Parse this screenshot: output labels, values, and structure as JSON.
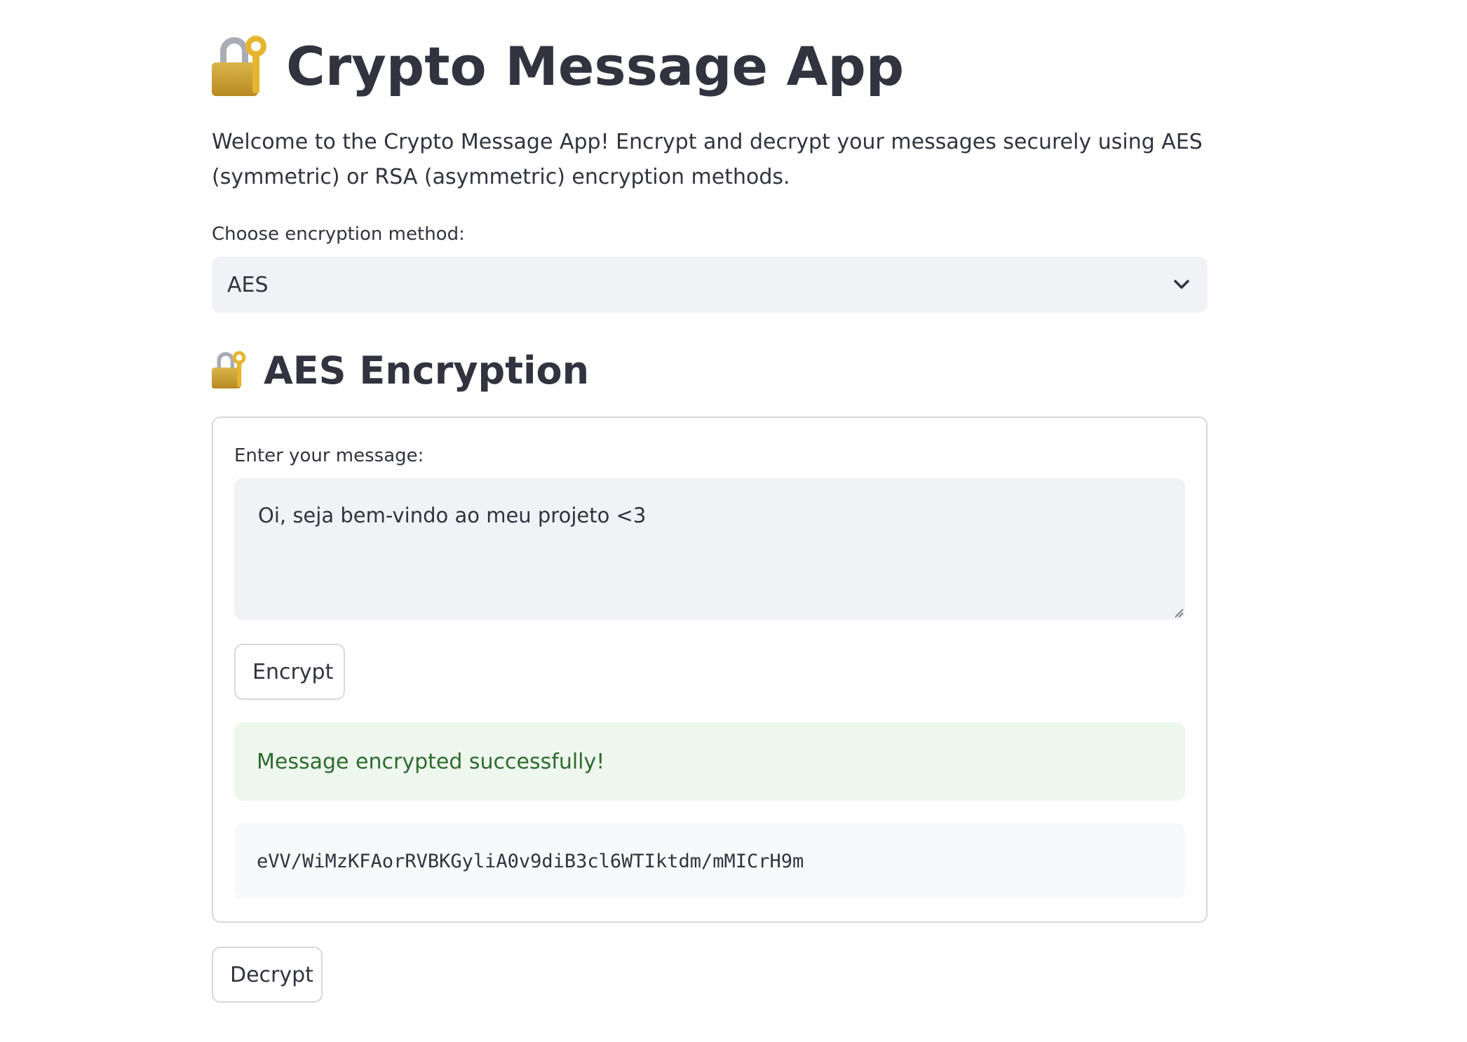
{
  "header": {
    "title": "Crypto Message App",
    "title_icon": "lock-with-key-icon"
  },
  "intro": {
    "text": "Welcome to the Crypto Message App! Encrypt and decrypt your messages securely using AES (symmetric) or RSA (asymmetric) encryption methods."
  },
  "method_select": {
    "label": "Choose encryption method:",
    "value": "AES",
    "icon": "chevron-down-icon"
  },
  "aes_section": {
    "title": "AES Encryption",
    "title_icon": "lock-with-key-icon",
    "message_label": "Enter your message:",
    "message_value": "Oi, seja bem-vindo ao meu projeto <3",
    "encrypt_label": "Encrypt",
    "success_text": "Message encrypted successfully!",
    "ciphertext": "eVV/WiMzKFAorRVBKGyliA0v9diB3cl6WTIktdm/mMICrH9m"
  },
  "decrypt": {
    "label": "Decrypt"
  },
  "colors": {
    "text": "#31333f",
    "input_bg": "#f0f2f6",
    "success_bg": "#eef7ee",
    "success_text": "#2e6b2e",
    "border": "#d6d8dd"
  }
}
